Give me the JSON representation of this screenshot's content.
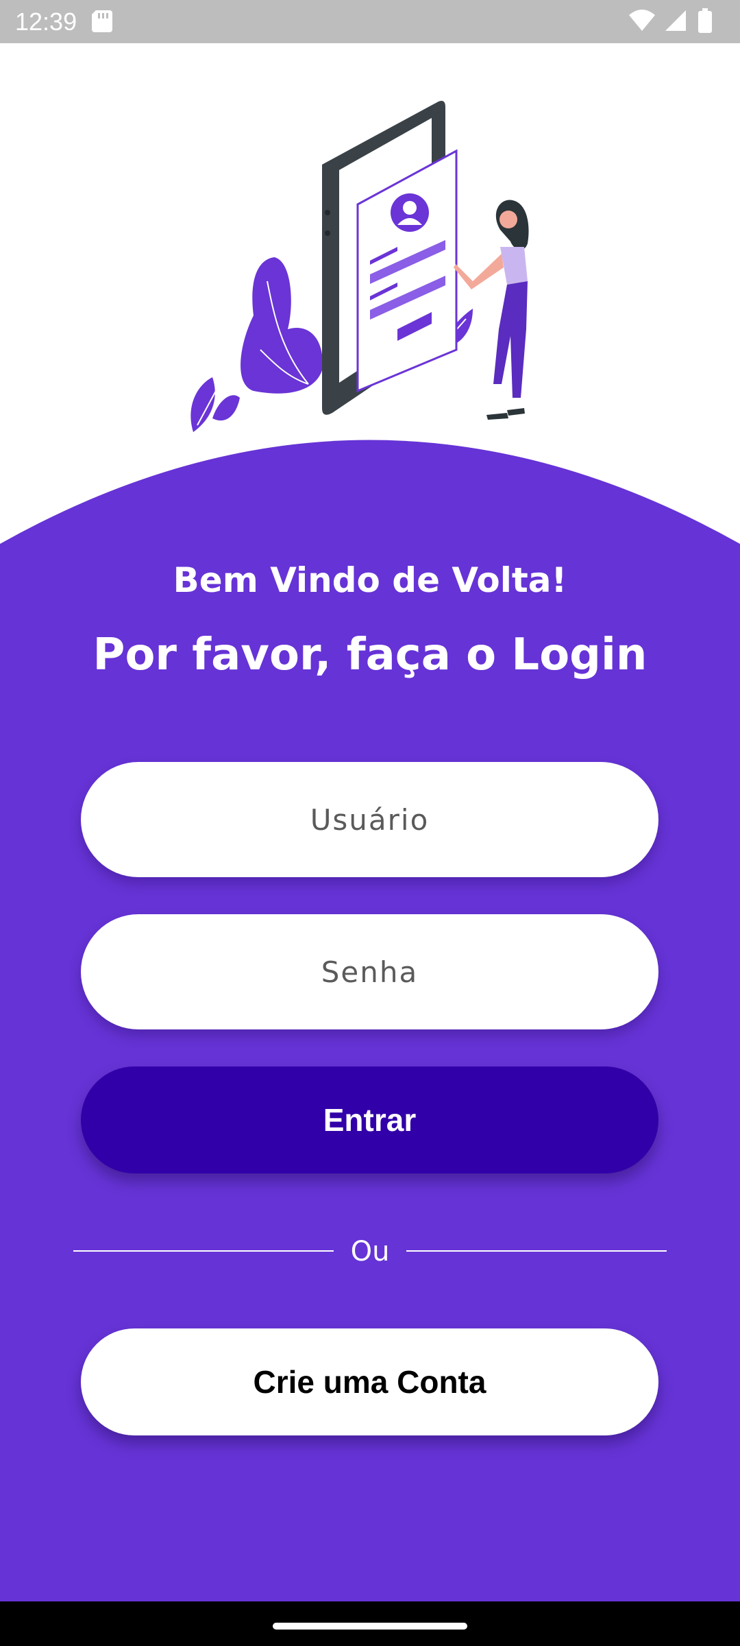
{
  "status_bar": {
    "time": "12:39"
  },
  "header": {
    "welcome": "Bem Vindo de Volta!",
    "subtitle": "Por favor, faça o Login"
  },
  "form": {
    "username_placeholder": "Usuário",
    "password_placeholder": "Senha",
    "login_button": "Entrar",
    "divider_text": "Ou",
    "create_account_button": "Crie uma Conta"
  },
  "colors": {
    "primary": "#6633d6",
    "button_dark": "#3200a8",
    "status_bar": "#bdbdbd"
  },
  "icons": {
    "status_left": "sd-card-icon",
    "status_right": [
      "wifi-icon",
      "signal-icon",
      "battery-icon"
    ]
  }
}
